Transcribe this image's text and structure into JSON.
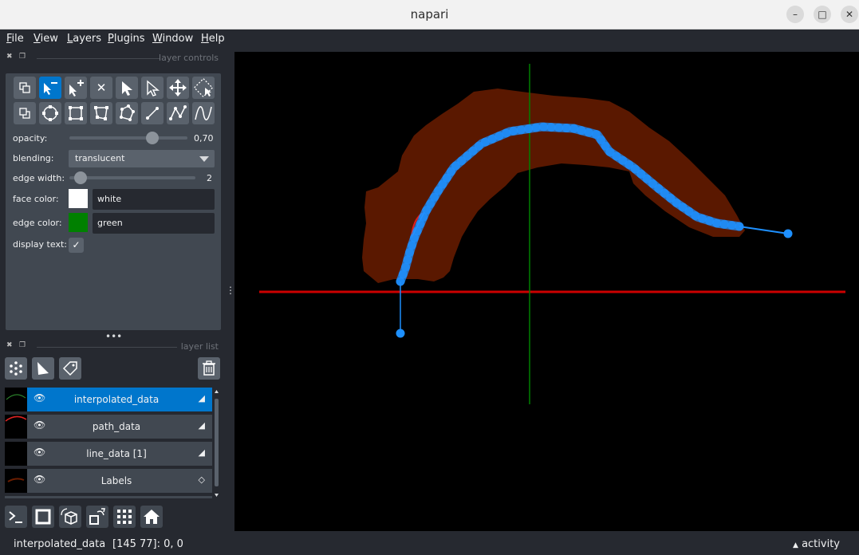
{
  "window": {
    "title": "napari"
  },
  "menu": [
    "File",
    "View",
    "Layers",
    "Plugins",
    "Window",
    "Help"
  ],
  "layer_controls": {
    "header": "layer controls",
    "opacity_label": "opacity:",
    "opacity_value": "0,70",
    "opacity_level": 0.7,
    "blending_label": "blending:",
    "blending_value": "translucent",
    "edge_width_label": "edge width:",
    "edge_width_value": "2",
    "face_color_label": "face color:",
    "face_color_value": "white",
    "face_color_hex": "#ffffff",
    "edge_color_label": "edge color:",
    "edge_color_value": "green",
    "edge_color_hex": "#008000",
    "display_text_label": "display text:",
    "display_text_checked": true
  },
  "layer_list": {
    "header": "layer list",
    "layers": [
      {
        "name": "interpolated_data",
        "type": "shapes",
        "selected": true,
        "visible": true
      },
      {
        "name": "path_data",
        "type": "shapes",
        "selected": false,
        "visible": true
      },
      {
        "name": "line_data [1]",
        "type": "shapes",
        "selected": false,
        "visible": true
      },
      {
        "name": "Labels",
        "type": "labels",
        "selected": false,
        "visible": true
      }
    ]
  },
  "status": {
    "layer": "interpolated_data",
    "coords": "[145 77]: 0, 0",
    "activity": "activity"
  },
  "colors": {
    "accent": "#0076cc",
    "label_region": "#5a1800",
    "path_blue": "#1e90ff",
    "axis_red": "#cc0000",
    "axis_green": "#008000"
  }
}
